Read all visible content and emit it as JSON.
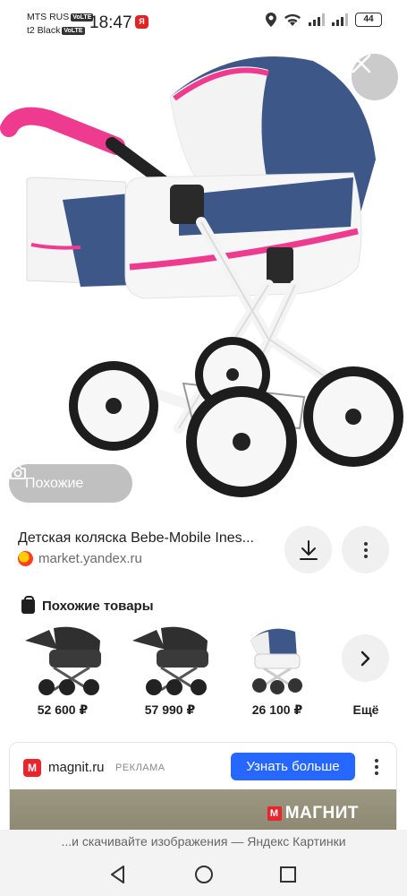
{
  "status_bar": {
    "carrier_1": "MTS RUS",
    "carrier_2": "t2 Black",
    "volte": "VoLTE",
    "time": "18:47",
    "battery": "44"
  },
  "hero": {
    "similar_label": "Похожие"
  },
  "result": {
    "title": "Детская коляска Bebe-Mobile Ines...",
    "source": "market.yandex.ru"
  },
  "similar_products": {
    "heading": "Похожие товары",
    "items": [
      {
        "price": "52 600 ₽"
      },
      {
        "price": "57 990 ₽"
      },
      {
        "price": "26 100 ₽"
      }
    ],
    "more_label": "Ещё"
  },
  "ad": {
    "logo_letter": "M",
    "domain": "magnit.ru",
    "tag": "РЕКЛАМА",
    "cta": "Узнать больше",
    "brand": "МАГНИТ"
  },
  "footer_hint": "...и скачивайте изображения — Яндекс Картинки",
  "colors": {
    "accent_blue": "#2668ff",
    "pram_navy": "#3d5788",
    "pram_pink": "#ee3b8f",
    "magnit_red": "#e8242c"
  }
}
